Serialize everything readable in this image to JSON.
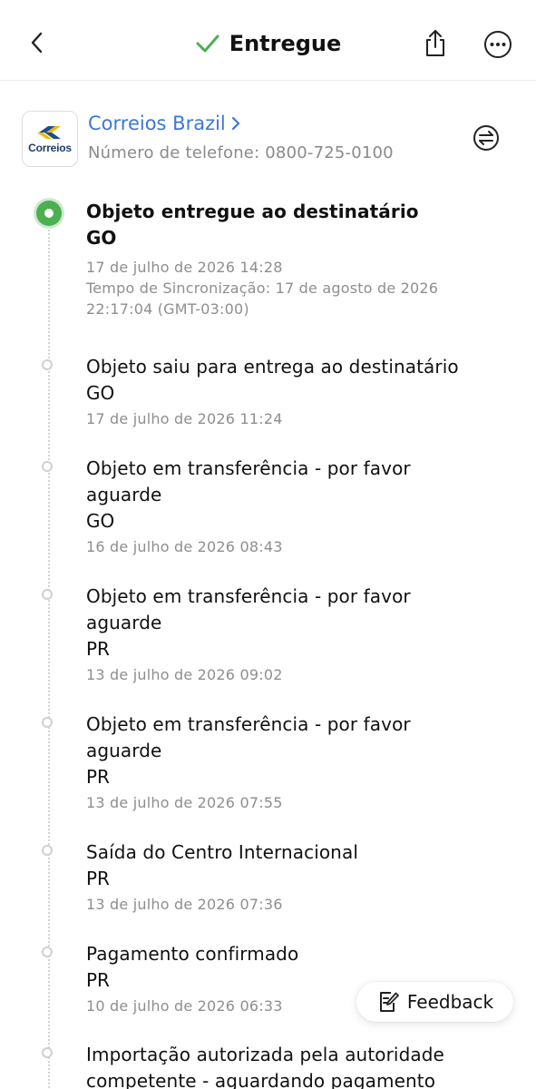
{
  "header": {
    "status_title": "Entregue",
    "status_color": "#4caf50"
  },
  "carrier": {
    "logo_text": "Correios",
    "name": "Correios Brazil",
    "phone": "Número de telefone: 0800-725-0100",
    "name_color": "#3b78d8"
  },
  "events": [
    {
      "title": "Objeto entregue ao destinatário",
      "location": "GO",
      "date": "17 de julho de 2026 14:28",
      "sync_line1": "Tempo de Sincronização: 17 de agosto de 2026",
      "sync_line2": "22:17:04 (GMT-03:00)"
    },
    {
      "title": "Objeto saiu para entrega ao destinatário",
      "location": "GO",
      "date": "17 de julho de 2026 11:24"
    },
    {
      "title": "Objeto em transferência - por favor aguarde",
      "location": "GO",
      "date": "16 de julho de 2026 08:43"
    },
    {
      "title": "Objeto em transferência - por favor aguarde",
      "location": "PR",
      "date": "13 de julho de 2026 09:02"
    },
    {
      "title": "Objeto em transferência - por favor aguarde",
      "location": "PR",
      "date": "13 de julho de 2026 07:55"
    },
    {
      "title": "Saída do Centro Internacional",
      "location": "PR",
      "date": "13 de julho de 2026 07:36"
    },
    {
      "title": "Pagamento confirmado",
      "location": "PR",
      "date": "10 de julho de 2026 06:33"
    },
    {
      "title": "Importação autorizada pela autoridade competente - aguardando pagamento",
      "location": "",
      "date": ""
    }
  ],
  "feedback": {
    "label": "Feedback"
  },
  "icons": {
    "back": "chevron-left-icon",
    "status": "checkmark-icon",
    "share": "share-icon",
    "more": "more-icon",
    "carrier_chevron": "chevron-right-icon",
    "swap": "swap-icon",
    "feedback": "edit-note-icon"
  }
}
